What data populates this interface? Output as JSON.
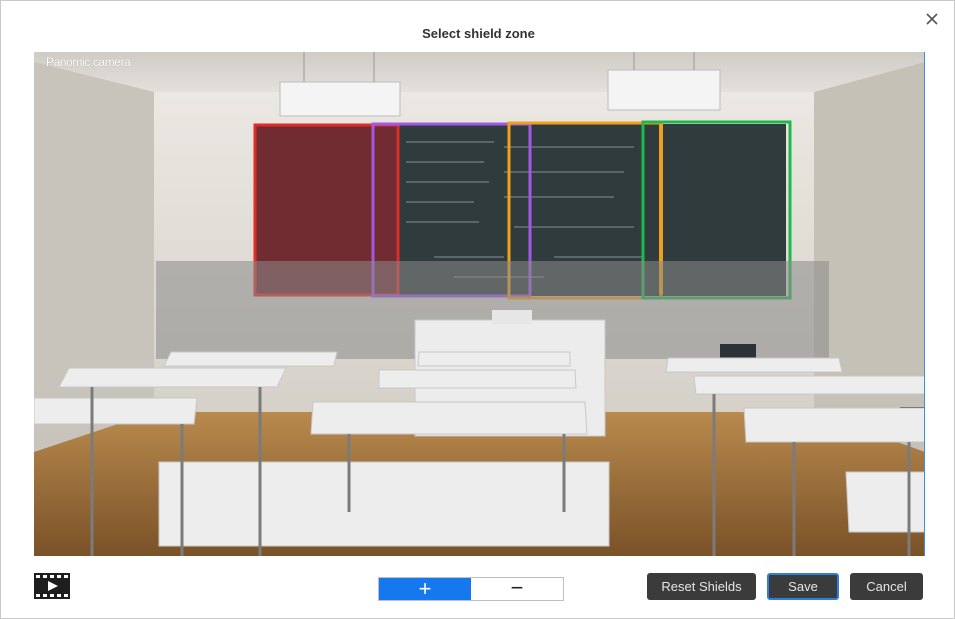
{
  "dialog": {
    "title": "Select shield zone",
    "close_icon": "close-icon"
  },
  "viewport": {
    "camera_label": "Panomic camera",
    "shield_zones": [
      {
        "name": "red",
        "color": "#e02b2b"
      },
      {
        "name": "purple",
        "color": "#a259e6"
      },
      {
        "name": "orange",
        "color": "#f0a01a"
      },
      {
        "name": "green",
        "color": "#1fb84a"
      }
    ]
  },
  "toolbar": {
    "video_icon": "film-play-icon",
    "zoom_in_label": "+",
    "zoom_out_label": "−",
    "reset_label": "Reset Shields",
    "save_label": "Save",
    "cancel_label": "Cancel"
  },
  "colors": {
    "accent": "#1678ef",
    "button_dark": "#3b3b3b"
  }
}
